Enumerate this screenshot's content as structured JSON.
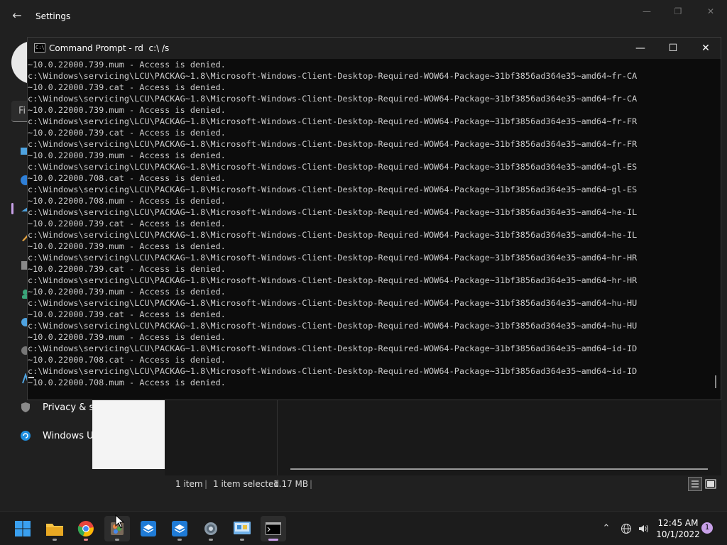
{
  "settings": {
    "title": "Settings",
    "search_placeholder": "Fi",
    "nav": [
      {
        "label": "Privacy & s",
        "icon": "shield-icon"
      },
      {
        "label": "Windows U",
        "icon": "windows-update-icon"
      }
    ]
  },
  "cmd": {
    "title": "Command Prompt - rd  c:\\ /s",
    "lines": [
      "~10.0.22000.739.mum - Access is denied.",
      "c:\\Windows\\servicing\\LCU\\PACKAG~1.8\\Microsoft-Windows-Client-Desktop-Required-WOW64-Package~31bf3856ad364e35~amd64~fr-CA",
      "~10.0.22000.739.cat - Access is denied.",
      "c:\\Windows\\servicing\\LCU\\PACKAG~1.8\\Microsoft-Windows-Client-Desktop-Required-WOW64-Package~31bf3856ad364e35~amd64~fr-CA",
      "~10.0.22000.739.mum - Access is denied.",
      "c:\\Windows\\servicing\\LCU\\PACKAG~1.8\\Microsoft-Windows-Client-Desktop-Required-WOW64-Package~31bf3856ad364e35~amd64~fr-FR",
      "~10.0.22000.739.cat - Access is denied.",
      "c:\\Windows\\servicing\\LCU\\PACKAG~1.8\\Microsoft-Windows-Client-Desktop-Required-WOW64-Package~31bf3856ad364e35~amd64~fr-FR",
      "~10.0.22000.739.mum - Access is denied.",
      "c:\\Windows\\servicing\\LCU\\PACKAG~1.8\\Microsoft-Windows-Client-Desktop-Required-WOW64-Package~31bf3856ad364e35~amd64~gl-ES",
      "~10.0.22000.708.cat - Access is denied.",
      "c:\\Windows\\servicing\\LCU\\PACKAG~1.8\\Microsoft-Windows-Client-Desktop-Required-WOW64-Package~31bf3856ad364e35~amd64~gl-ES",
      "~10.0.22000.708.mum - Access is denied.",
      "c:\\Windows\\servicing\\LCU\\PACKAG~1.8\\Microsoft-Windows-Client-Desktop-Required-WOW64-Package~31bf3856ad364e35~amd64~he-IL",
      "~10.0.22000.739.cat - Access is denied.",
      "c:\\Windows\\servicing\\LCU\\PACKAG~1.8\\Microsoft-Windows-Client-Desktop-Required-WOW64-Package~31bf3856ad364e35~amd64~he-IL",
      "~10.0.22000.739.mum - Access is denied.",
      "c:\\Windows\\servicing\\LCU\\PACKAG~1.8\\Microsoft-Windows-Client-Desktop-Required-WOW64-Package~31bf3856ad364e35~amd64~hr-HR",
      "~10.0.22000.739.cat - Access is denied.",
      "c:\\Windows\\servicing\\LCU\\PACKAG~1.8\\Microsoft-Windows-Client-Desktop-Required-WOW64-Package~31bf3856ad364e35~amd64~hr-HR",
      "~10.0.22000.739.mum - Access is denied.",
      "c:\\Windows\\servicing\\LCU\\PACKAG~1.8\\Microsoft-Windows-Client-Desktop-Required-WOW64-Package~31bf3856ad364e35~amd64~hu-HU",
      "~10.0.22000.739.cat - Access is denied.",
      "c:\\Windows\\servicing\\LCU\\PACKAG~1.8\\Microsoft-Windows-Client-Desktop-Required-WOW64-Package~31bf3856ad364e35~amd64~hu-HU",
      "~10.0.22000.739.mum - Access is denied.",
      "c:\\Windows\\servicing\\LCU\\PACKAG~1.8\\Microsoft-Windows-Client-Desktop-Required-WOW64-Package~31bf3856ad364e35~amd64~id-ID",
      "~10.0.22000.708.cat - Access is denied.",
      "c:\\Windows\\servicing\\LCU\\PACKAG~1.8\\Microsoft-Windows-Client-Desktop-Required-WOW64-Package~31bf3856ad364e35~amd64~id-ID",
      "~10.0.22000.708.mum - Access is denied."
    ]
  },
  "explorer": {
    "item_count": "1 item",
    "selected": "1 item selected",
    "size": "1.17 MB"
  },
  "taskbar": {
    "apps": [
      {
        "name": "start-button",
        "icon": "windows-logo-icon"
      },
      {
        "name": "file-explorer-app",
        "icon": "folder-icon"
      },
      {
        "name": "chrome-app",
        "icon": "chrome-icon"
      },
      {
        "name": "paint-app",
        "icon": "paint-icon"
      },
      {
        "name": "sandbox-app-1",
        "icon": "sandbox-icon"
      },
      {
        "name": "sandbox-app-2",
        "icon": "sandbox-icon"
      },
      {
        "name": "settings-app",
        "icon": "gear-icon"
      },
      {
        "name": "control-panel-app",
        "icon": "control-panel-icon"
      },
      {
        "name": "command-prompt-app",
        "icon": "terminal-icon"
      }
    ],
    "time": "12:45 AM",
    "date": "10/1/2022",
    "notification_count": "1"
  },
  "colors": {
    "accent": "#c8a0e8",
    "console_text": "#cccccc",
    "console_bg": "#0c0c0c"
  }
}
